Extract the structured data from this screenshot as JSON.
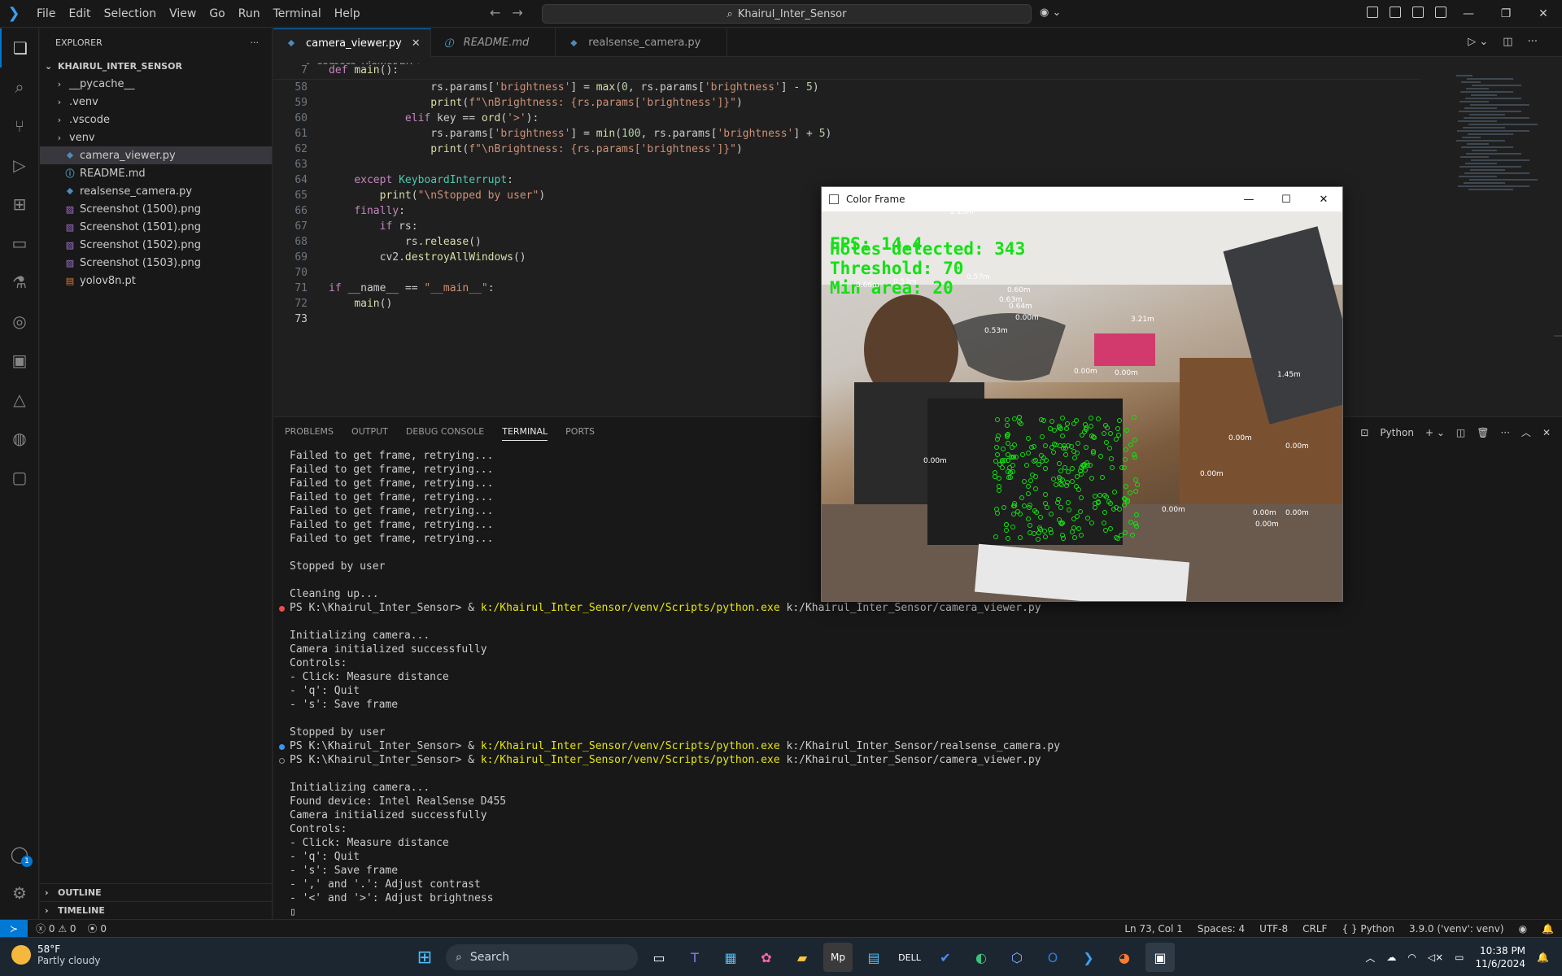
{
  "titlebar": {
    "menu": [
      "File",
      "Edit",
      "Selection",
      "View",
      "Go",
      "Run",
      "Terminal",
      "Help"
    ],
    "search_text": "Khairul_Inter_Sensor"
  },
  "sidebar": {
    "title": "EXPLORER",
    "folder": "KHAIRUL_INTER_SENSOR",
    "items": [
      {
        "label": "__pycache__",
        "type": "folder"
      },
      {
        "label": ".venv",
        "type": "folder"
      },
      {
        "label": ".vscode",
        "type": "folder"
      },
      {
        "label": "venv",
        "type": "folder"
      },
      {
        "label": "camera_viewer.py",
        "type": "py",
        "selected": true
      },
      {
        "label": "README.md",
        "type": "md"
      },
      {
        "label": "realsense_camera.py",
        "type": "py"
      },
      {
        "label": "Screenshot (1500).png",
        "type": "png"
      },
      {
        "label": "Screenshot (1501).png",
        "type": "png"
      },
      {
        "label": "Screenshot (1502).png",
        "type": "png"
      },
      {
        "label": "Screenshot (1503).png",
        "type": "png"
      },
      {
        "label": "yolov8n.pt",
        "type": "pt"
      }
    ],
    "outline": "OUTLINE",
    "timeline": "TIMELINE"
  },
  "tabs": [
    {
      "label": "camera_viewer.py",
      "active": true
    },
    {
      "label": "README.md",
      "active": false
    },
    {
      "label": "realsense_camera.py",
      "active": false
    }
  ],
  "breadcrumb": {
    "file": "camera_viewer.py",
    "more": "..."
  },
  "code": {
    "sticky_line": {
      "num": "7",
      "text": "def main():"
    },
    "lines": [
      {
        "num": "58",
        "text": "                rs.params['brightness'] = max(0, rs.params['brightness'] - 5)"
      },
      {
        "num": "59",
        "text": "                print(f\"\\nBrightness: {rs.params['brightness']}\")"
      },
      {
        "num": "60",
        "text": "            elif key == ord('>'):"
      },
      {
        "num": "61",
        "text": "                rs.params['brightness'] = min(100, rs.params['brightness'] + 5)"
      },
      {
        "num": "62",
        "text": "                print(f\"\\nBrightness: {rs.params['brightness']}\")"
      },
      {
        "num": "63",
        "text": ""
      },
      {
        "num": "64",
        "text": "    except KeyboardInterrupt:"
      },
      {
        "num": "65",
        "text": "        print(\"\\nStopped by user\")"
      },
      {
        "num": "66",
        "text": "    finally:"
      },
      {
        "num": "67",
        "text": "        if rs:"
      },
      {
        "num": "68",
        "text": "            rs.release()"
      },
      {
        "num": "69",
        "text": "        cv2.destroyAllWindows()"
      },
      {
        "num": "70",
        "text": ""
      },
      {
        "num": "71",
        "text": "if __name__ == \"__main__\":"
      },
      {
        "num": "72",
        "text": "    main()"
      },
      {
        "num": "73",
        "text": ""
      }
    ]
  },
  "panel": {
    "tabs": [
      "PROBLEMS",
      "OUTPUT",
      "DEBUG CONSOLE",
      "TERMINAL",
      "PORTS"
    ],
    "active_tab": "TERMINAL",
    "shell": "Python",
    "terminal_lines": [
      {
        "text": "Failed to get frame, retrying...",
        "dot": ""
      },
      {
        "text": "Failed to get frame, retrying...",
        "dot": ""
      },
      {
        "text": "Failed to get frame, retrying...",
        "dot": ""
      },
      {
        "text": "Failed to get frame, retrying...",
        "dot": ""
      },
      {
        "text": "Failed to get frame, retrying...",
        "dot": ""
      },
      {
        "text": "Failed to get frame, retrying...",
        "dot": ""
      },
      {
        "text": "Failed to get frame, retrying...",
        "dot": ""
      },
      {
        "text": "",
        "dot": ""
      },
      {
        "text": "Stopped by user",
        "dot": ""
      },
      {
        "text": "",
        "dot": ""
      },
      {
        "text": "Cleaning up...",
        "dot": ""
      },
      {
        "prompt": "PS K:\\Khairul_Inter_Sensor> & ",
        "exe": "k:/Khairul_Inter_Sensor/venv/Scripts/python.exe",
        "arg": " k:/Khairul_Inter_Sensor/camera_viewer.py",
        "dot": "error"
      },
      {
        "text": "",
        "dot": ""
      },
      {
        "text": "Initializing camera...",
        "dot": ""
      },
      {
        "text": "Camera initialized successfully",
        "dot": ""
      },
      {
        "text": "Controls:",
        "dot": ""
      },
      {
        "text": "- Click: Measure distance",
        "dot": ""
      },
      {
        "text": "- 'q': Quit",
        "dot": ""
      },
      {
        "text": "- 's': Save frame",
        "dot": ""
      },
      {
        "text": "",
        "dot": ""
      },
      {
        "text": "Stopped by user",
        "dot": ""
      },
      {
        "prompt": "PS K:\\Khairul_Inter_Sensor> & ",
        "exe": "k:/Khairul_Inter_Sensor/venv/Scripts/python.exe",
        "arg": " k:/Khairul_Inter_Sensor/realsense_camera.py",
        "dot": "info"
      },
      {
        "prompt": "PS K:\\Khairul_Inter_Sensor> & ",
        "exe": "k:/Khairul_Inter_Sensor/venv/Scripts/python.exe",
        "arg": " k:/Khairul_Inter_Sensor/camera_viewer.py",
        "dot": "running"
      },
      {
        "text": "",
        "dot": ""
      },
      {
        "text": "Initializing camera...",
        "dot": ""
      },
      {
        "text": "Found device: Intel RealSense D455",
        "dot": ""
      },
      {
        "text": "Camera initialized successfully",
        "dot": ""
      },
      {
        "text": "Controls:",
        "dot": ""
      },
      {
        "text": "- Click: Measure distance",
        "dot": ""
      },
      {
        "text": "- 'q': Quit",
        "dot": ""
      },
      {
        "text": "- 's': Save frame",
        "dot": ""
      },
      {
        "text": "- ',' and '.': Adjust contrast",
        "dot": ""
      },
      {
        "text": "- '<' and '>': Adjust brightness",
        "dot": ""
      },
      {
        "text": "▯",
        "dot": ""
      }
    ]
  },
  "color_frame": {
    "title": "Color Frame",
    "overlay": [
      "FPS: 14.4",
      "Holes detected: 343",
      "Threshold: 70",
      "Min area: 20"
    ],
    "labels": [
      "2.28m",
      "0.66m",
      "0.53m",
      "0.57m",
      "0.60m",
      "0.63m",
      "0.64m",
      "0.00m",
      "0.53m",
      "3.21m",
      "0.00m",
      "0.00m",
      "1.45m",
      "0.00m",
      "0.00m",
      "0.00m",
      "0.00m",
      "0.00m",
      "0.00m",
      "0.00m",
      "0.00m"
    ]
  },
  "statusbar": {
    "errors": "0",
    "warnings": "0",
    "ports": "0",
    "position": "Ln 73, Col 1",
    "spaces": "Spaces: 4",
    "encoding": "UTF-8",
    "eol": "CRLF",
    "language": "Python",
    "interpreter": "3.9.0 ('venv': venv)"
  },
  "taskbar": {
    "temp": "58°F",
    "weather": "Partly cloudy",
    "search": "Search",
    "time": "10:38 PM",
    "date": "11/6/2024"
  },
  "colors": {
    "accent": "#0078d4",
    "overlay_green": "#14e014",
    "terminal_yellow": "#e5e510"
  }
}
